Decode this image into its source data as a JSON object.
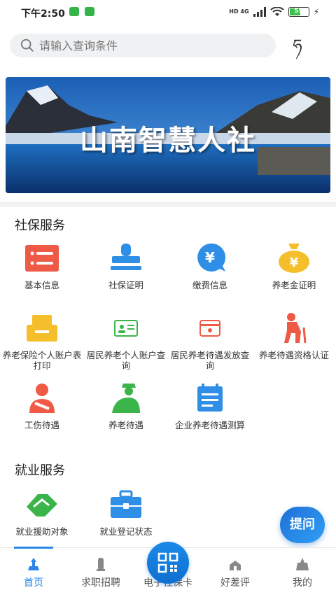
{
  "status_bar": {
    "time": "下午2:50",
    "network": "HD 4G",
    "battery": 59,
    "battery_label": "59"
  },
  "header": {
    "search_placeholder": "请输入查询条件",
    "lang_button_label": "ཧ"
  },
  "banner": {
    "title": "山南智慧人社"
  },
  "social_security": {
    "title": "社保服务",
    "items": [
      {
        "label": "基本信息"
      },
      {
        "label": "社保证明"
      },
      {
        "label": "缴费信息"
      },
      {
        "label": "养老金证明"
      },
      {
        "label": "养老保险个人账户表打印"
      },
      {
        "label": "居民养老个人账户查询"
      },
      {
        "label": "居民养老待遇发放查询"
      },
      {
        "label": "养老待遇资格认证"
      },
      {
        "label": "工伤待遇"
      },
      {
        "label": "养老待遇"
      },
      {
        "label": "企业养老待遇测算"
      }
    ]
  },
  "employment": {
    "title": "就业服务",
    "items": [
      {
        "label": "就业援助对象"
      },
      {
        "label": "就业登记状态"
      }
    ]
  },
  "fab": {
    "label": "提问"
  },
  "tabbar": {
    "tabs": [
      {
        "label": "首页"
      },
      {
        "label": "求职招聘"
      },
      {
        "label": "电子社保卡"
      },
      {
        "label": "好差评"
      },
      {
        "label": "我的"
      }
    ]
  },
  "colors": {
    "accent": "#2a86e8",
    "red": "#ee5a45",
    "blue": "#2f8fe6",
    "yellow": "#f5bf2c",
    "green": "#3bb54a"
  }
}
